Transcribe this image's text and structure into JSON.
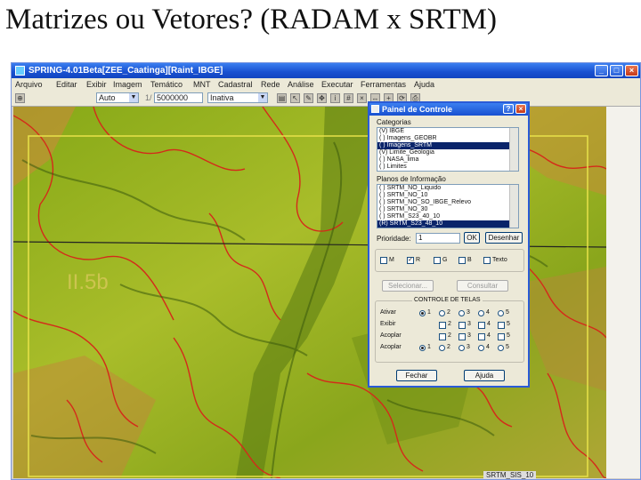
{
  "slide": {
    "title": "Matrizes ou Vetores? (RADAM x SRTM)"
  },
  "window": {
    "title": "SPRING-4.01Beta[ZEE_Caatinga][Raint_IBGE]",
    "controls": [
      "_",
      "□",
      "×"
    ],
    "menu": [
      "Arquivo",
      "Editar",
      "Exibir",
      "Imagem",
      "Temático",
      "MNT",
      "Cadastral",
      "Rede",
      "Análise",
      "Executar",
      "Ferramentas",
      "Ajuda"
    ],
    "toolbar": {
      "zoom_mode": "Auto",
      "scale_label": "1/",
      "scale_value": "5000000",
      "mode": "Inativa"
    }
  },
  "map": {
    "label": "II.5b",
    "status": "SRTM_SIS_10"
  },
  "panel": {
    "title": "Painel de Controle",
    "categories_label": "Categorias",
    "categories": [
      "IBGE",
      "Imagens_GEOBR",
      "Imagens_SRTM",
      "Limite_Geologia",
      "NASA_lima",
      "Limites"
    ],
    "categories_checked": [
      true,
      false,
      false,
      true,
      false,
      false
    ],
    "categories_selected": 2,
    "planes_label": "Planos de Informação",
    "planes": [
      "SRTM_NO_Liquido",
      "SRTM_NO_10",
      "SRTM_NO_SO_IBGE_Relevo",
      "SRTM_NO_30",
      "SRTM_S23_40_10",
      "SRTM_S23_48_10"
    ],
    "planes_selected": 5,
    "prioridade_label": "Prioridade:",
    "prioridade_value": "1",
    "ok_label": "OK",
    "desenhar_label": "Desenhar",
    "channels": [
      "M",
      "R",
      "G",
      "B",
      "Texto"
    ],
    "channels_checked": [
      false,
      true,
      false,
      false,
      false
    ],
    "selecionar_label": "Selecionar...",
    "consultar_label": "Consultar",
    "tela_group_label": "CONTROLE DE TELAS",
    "tela_rows": [
      "Ativar",
      "Exibir",
      "Acoplar",
      "Acoplar"
    ],
    "tela_numbers": [
      "1",
      "2",
      "3",
      "4",
      "5"
    ],
    "fechar_label": "Fechar",
    "ajuda_label": "Ajuda"
  },
  "colors": {
    "map_base": "#9ab81e",
    "vector_red": "#d42a1a",
    "frame_yellow": "#e8e24a",
    "titlebar_blue": "#1850d0"
  }
}
